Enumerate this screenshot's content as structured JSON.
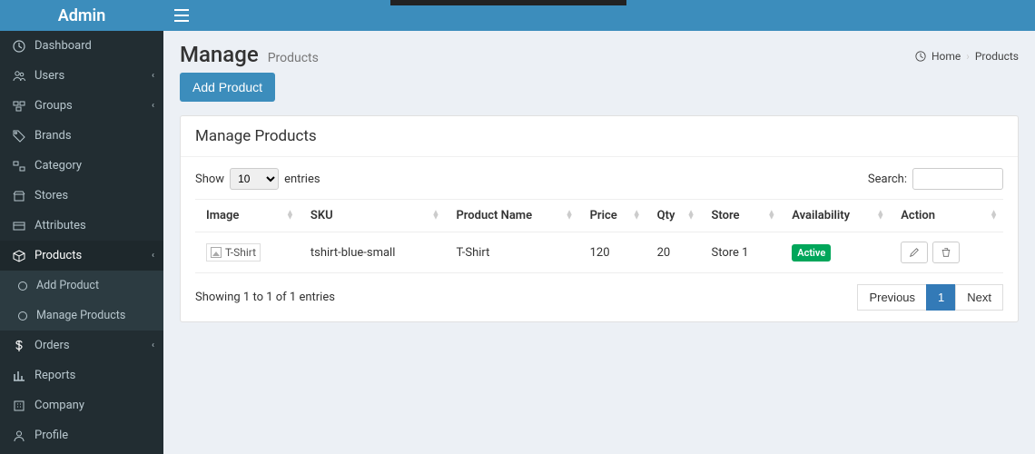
{
  "header": {
    "logo": "Admin"
  },
  "sidebar": {
    "items": [
      {
        "label": "Dashboard"
      },
      {
        "label": "Users"
      },
      {
        "label": "Groups"
      },
      {
        "label": "Brands"
      },
      {
        "label": "Category"
      },
      {
        "label": "Stores"
      },
      {
        "label": "Attributes"
      },
      {
        "label": "Products"
      },
      {
        "label": "Orders"
      },
      {
        "label": "Reports"
      },
      {
        "label": "Company"
      },
      {
        "label": "Profile"
      }
    ],
    "products_sub": [
      {
        "label": "Add Product"
      },
      {
        "label": "Manage Products"
      }
    ]
  },
  "page": {
    "title": "Manage",
    "subtitle": "Products",
    "breadcrumb_home": "Home",
    "breadcrumb_current": "Products",
    "add_button": "Add Product"
  },
  "panel": {
    "title": "Manage Products",
    "show_label": "Show",
    "entries_label": "entries",
    "page_size": "10",
    "search_label": "Search:",
    "columns": [
      "Image",
      "SKU",
      "Product Name",
      "Price",
      "Qty",
      "Store",
      "Availability",
      "Action"
    ],
    "rows": [
      {
        "image_alt": "T-Shirt",
        "sku": "tshirt-blue-small",
        "name": "T-Shirt",
        "price": "120",
        "qty": "20",
        "store": "Store 1",
        "availability": "Active"
      }
    ],
    "info": "Showing 1 to 1 of 1 entries",
    "pagination": {
      "prev": "Previous",
      "page": "1",
      "next": "Next"
    }
  }
}
